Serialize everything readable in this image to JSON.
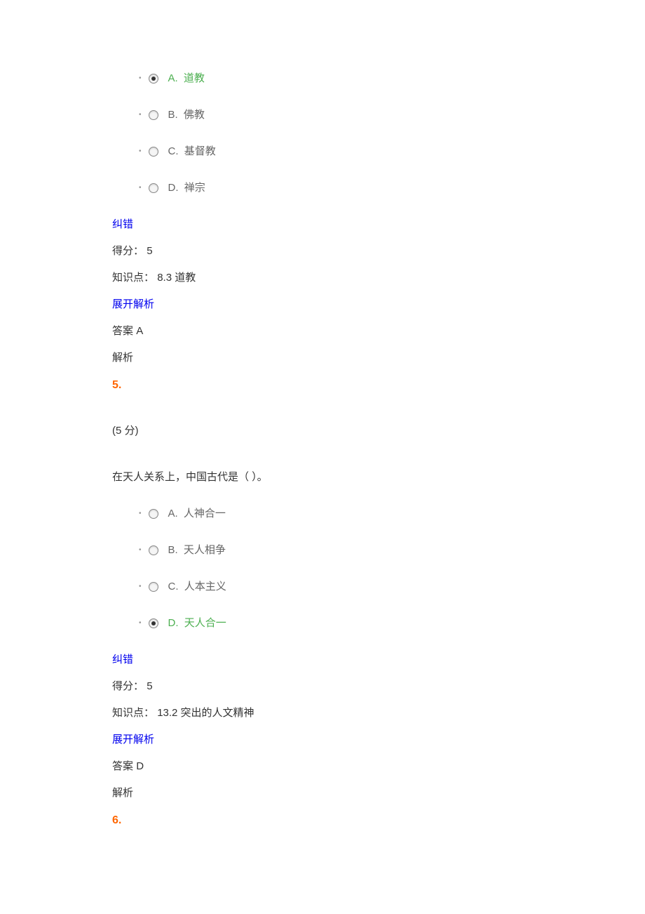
{
  "question4": {
    "options": [
      {
        "letter": "A.",
        "text": "道教",
        "selected": true,
        "correct": true
      },
      {
        "letter": "B.",
        "text": "佛教",
        "selected": false,
        "correct": false
      },
      {
        "letter": "C.",
        "text": "基督教",
        "selected": false,
        "correct": false
      },
      {
        "letter": "D.",
        "text": "禅宗",
        "selected": false,
        "correct": false
      }
    ],
    "correction_link": "纠错",
    "score_label": "得分：",
    "score_value": "5",
    "knowledge_label": "知识点：",
    "knowledge_value": "8.3 道教",
    "expand_link": "展开解析",
    "answer_label": "答案",
    "answer_value": "A",
    "explain_label": "解析"
  },
  "question5": {
    "number": "5.",
    "points": "(5 分)",
    "text": "在天人关系上，中国古代是（ ）。",
    "options": [
      {
        "letter": "A.",
        "text": "人神合一",
        "selected": false,
        "correct": false
      },
      {
        "letter": "B.",
        "text": "天人相争",
        "selected": false,
        "correct": false
      },
      {
        "letter": "C.",
        "text": "人本主义",
        "selected": false,
        "correct": false
      },
      {
        "letter": "D.",
        "text": "天人合一",
        "selected": true,
        "correct": true
      }
    ],
    "correction_link": "纠错",
    "score_label": "得分：",
    "score_value": "5",
    "knowledge_label": "知识点：",
    "knowledge_value": "13.2 突出的人文精神",
    "expand_link": "展开解析",
    "answer_label": "答案",
    "answer_value": "D",
    "explain_label": "解析"
  },
  "question6": {
    "number": "6."
  }
}
